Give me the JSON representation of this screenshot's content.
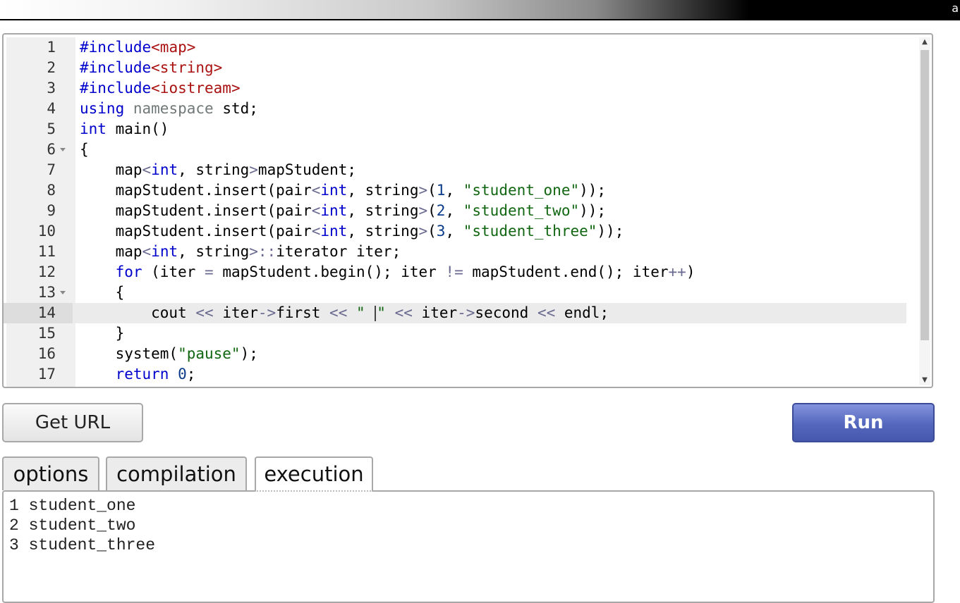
{
  "topbar": {
    "corner_text": "a"
  },
  "editor": {
    "lines": [
      "1",
      "2",
      "3",
      "4",
      "5",
      "6",
      "7",
      "8",
      "9",
      "10",
      "11",
      "12",
      "13",
      "14",
      "15",
      "16",
      "17"
    ],
    "active_line": 14
  },
  "buttons": {
    "get_url": "Get URL",
    "run": "Run"
  },
  "tabs": {
    "options": "options",
    "compilation": "compilation",
    "execution": "execution"
  },
  "output": {
    "lines": [
      "1 student_one",
      "2 student_two",
      "3 student_three"
    ]
  },
  "colors": {
    "run_button": "#5367bd",
    "keyword": "#0000cc",
    "string": "#116611",
    "include": "#aa1111"
  }
}
